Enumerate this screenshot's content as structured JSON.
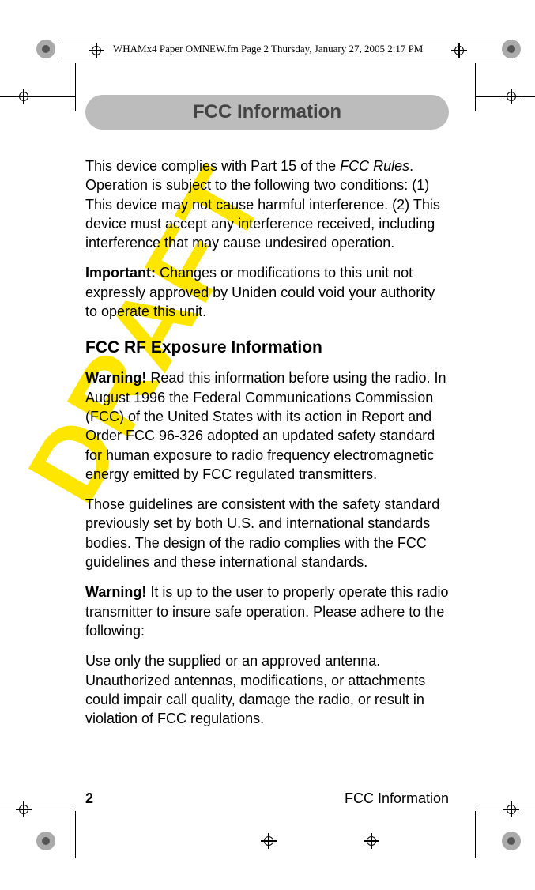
{
  "header_strip": "WHAMx4 Paper OMNEW.fm  Page 2  Thursday, January 27, 2005  2:17 PM",
  "watermark": "DRAFT",
  "title": "FCC Information",
  "p1_a": "This device complies with Part 15 of the ",
  "p1_b": "FCC Rules",
  "p1_c": ". Operation is subject to the following two conditions: (1) This device may not cause harmful interference. (2) This device must accept any interference received, including interference that may cause undesired operation.",
  "p2_a": "Important:",
  "p2_b": " Changes or modifications to this unit not expressly approved by Uniden could void your authority to operate this unit.",
  "subhead": "FCC RF Exposure Information",
  "p3_a": "Warning!",
  "p3_b": " Read this information before using the radio. In August 1996 the Federal Communications Commission (FCC) of the United States with its action in Report and Order FCC 96-326 adopted an updated safety standard for human exposure to radio frequency electromagnetic energy emitted by FCC regulated transmitters.",
  "p4": "Those guidelines are consistent with the safety standard previously set by both U.S. and international standards bodies. The design of the radio complies with the FCC guidelines and these international standards.",
  "p5_a": "Warning!",
  "p5_b": " It is up to the user to properly operate this radio transmitter to insure safe operation. Please adhere to the following:",
  "p6": "Use only the supplied or an approved antenna. Unauthorized antennas, modifications, or attachments could impair call quality, damage the radio, or result in violation of FCC regulations.",
  "footer": {
    "page": "2",
    "title": "FCC Information"
  }
}
